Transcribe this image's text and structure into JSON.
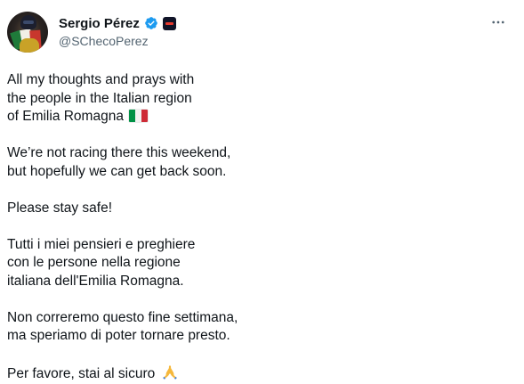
{
  "author": {
    "display_name": "Sergio Pérez",
    "handle": "@SChecoPerez",
    "verified_icon": "verified-badge-icon",
    "affiliate_icon": "team-affiliate-badge-icon"
  },
  "more_icon": "more-options-icon",
  "tweet": {
    "paragraphs": [
      {
        "lines": [
          "All my thoughts and prays with",
          "the people in the Italian region",
          "of Emilia Romagna"
        ]
      },
      {
        "lines": [
          "We’re not racing there this weekend,",
          "but hopefully we can get back soon."
        ]
      },
      {
        "lines": [
          "Please stay safe!"
        ]
      },
      {
        "lines": [
          "Tutti i miei pensieri e preghiere",
          "con le persone nella regione",
          "italiana dell'Emilia Romagna."
        ]
      },
      {
        "lines": [
          "Non correremo questo fine settimana,",
          "ma speriamo di poter tornare presto."
        ]
      },
      {
        "lines": [
          "Per favore, stai al sicuro"
        ]
      }
    ],
    "emoji": {
      "flag": "italy-flag-icon",
      "pray": "folded-hands-icon"
    }
  },
  "colors": {
    "text_primary": "#0f1419",
    "text_secondary": "#536471",
    "verified_blue": "#1d9bf0",
    "italy_green": "#009246",
    "italy_white": "#f1f2f1",
    "italy_red": "#ce2b37"
  }
}
